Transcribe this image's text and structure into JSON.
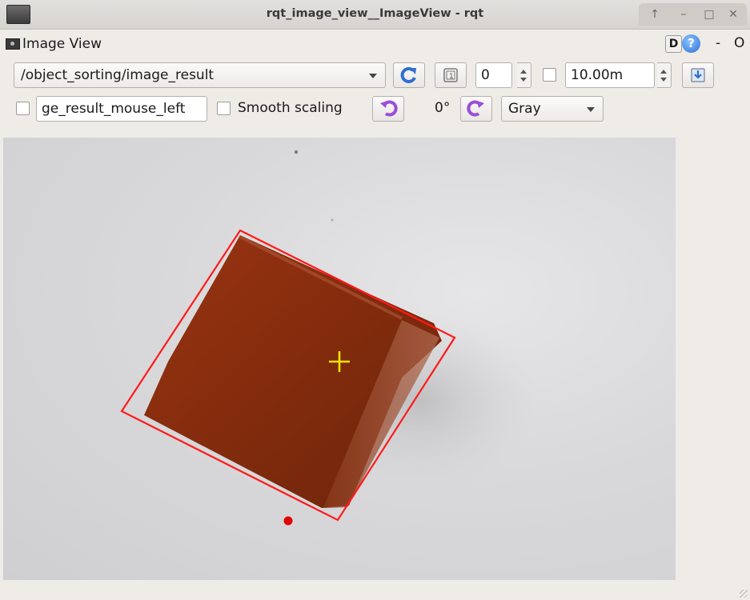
{
  "window": {
    "title": "rqt_image_view__ImageView - rqt",
    "buttons": {
      "restore": "↑",
      "minimize": "–",
      "maximize": "□",
      "close": "✕"
    }
  },
  "dock": {
    "title": "Image View",
    "d_button": "D",
    "help_button": "?",
    "minus": "-",
    "close_o": "O"
  },
  "toolbar": {
    "topic": "/object_sorting/image_result",
    "refresh_icon": "refresh-icon",
    "zoom_icon": "zoom-icon",
    "spin_value": "0",
    "timeout_value": "10.00m",
    "save_icon": "save-icon"
  },
  "toolbar2": {
    "mouse_topic": "ge_result_mouse_left",
    "smooth_scaling_label": "Smooth scaling",
    "rotation_label": "0°",
    "color_mode": "Gray"
  },
  "image": {
    "description_colors": {
      "cube": "#8b2d10",
      "box_outline": "#ff1a1a",
      "crosshair": "#f5e400",
      "marker": "#e00000"
    }
  }
}
